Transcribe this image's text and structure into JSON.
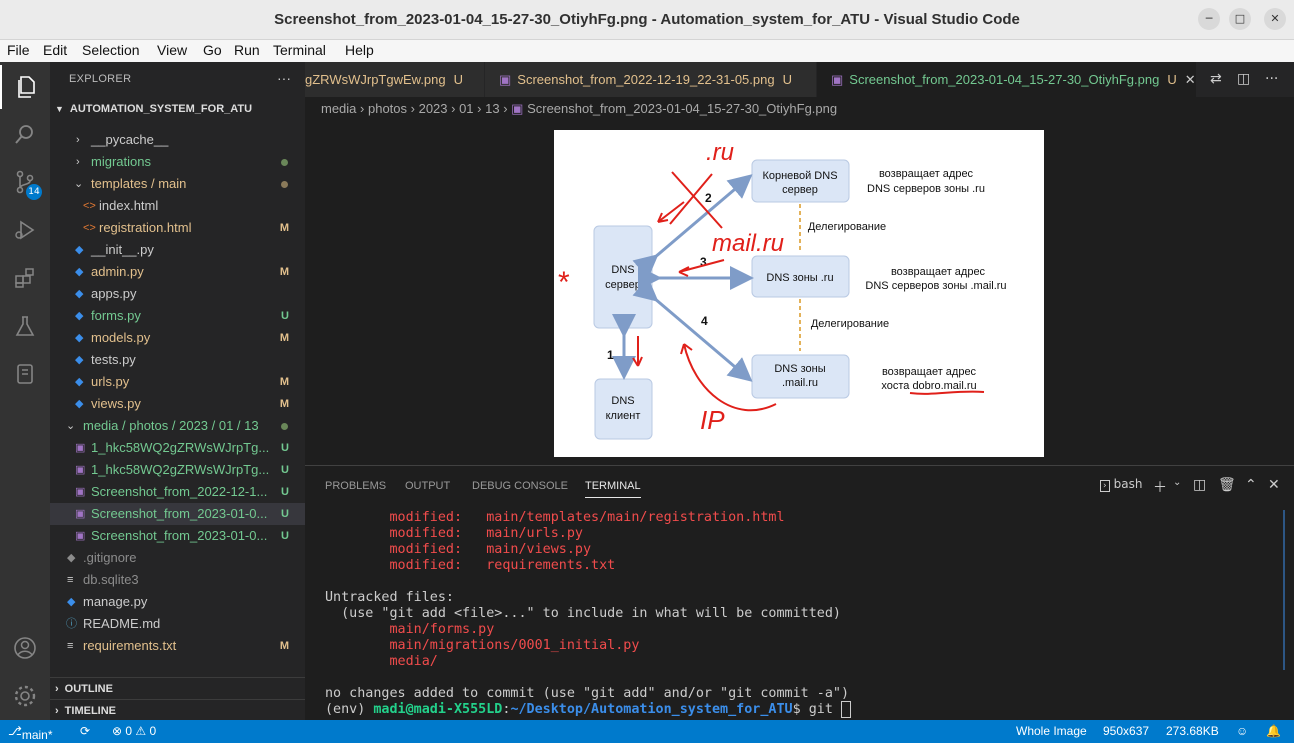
{
  "window": {
    "title": "Screenshot_from_2023-01-04_15-27-30_OtiyhFg.png - Automation_system_for_ATU - Visual Studio Code"
  },
  "menu": [
    "File",
    "Edit",
    "Selection",
    "View",
    "Go",
    "Run",
    "Terminal",
    "Help"
  ],
  "activity": {
    "scm_badge": "14"
  },
  "explorer": {
    "header": "EXPLORER",
    "more": "···",
    "project": "AUTOMATION_SYSTEM_FOR_ATU",
    "items": [
      {
        "name": "__pycache__",
        "status": ""
      },
      {
        "name": "migrations",
        "status": ""
      },
      {
        "name": "templates / main",
        "status": ""
      },
      {
        "name": "index.html",
        "status": ""
      },
      {
        "name": "registration.html",
        "status": "M"
      },
      {
        "name": "__init__.py",
        "status": ""
      },
      {
        "name": "admin.py",
        "status": "M"
      },
      {
        "name": "apps.py",
        "status": ""
      },
      {
        "name": "forms.py",
        "status": "U"
      },
      {
        "name": "models.py",
        "status": "M"
      },
      {
        "name": "tests.py",
        "status": ""
      },
      {
        "name": "urls.py",
        "status": "M"
      },
      {
        "name": "views.py",
        "status": "M"
      },
      {
        "name": "media / photos / 2023 / 01 / 13",
        "status": ""
      },
      {
        "name": "1_hkc58WQ2gZRWsWJrpTg...",
        "status": "U"
      },
      {
        "name": "1_hkc58WQ2gZRWsWJrpTg...",
        "status": "U"
      },
      {
        "name": "Screenshot_from_2022-12-1...",
        "status": "U"
      },
      {
        "name": "Screenshot_from_2023-01-0...",
        "status": "U"
      },
      {
        "name": "Screenshot_from_2023-01-0...",
        "status": "U"
      },
      {
        "name": ".gitignore",
        "status": ""
      },
      {
        "name": "db.sqlite3",
        "status": ""
      },
      {
        "name": "manage.py",
        "status": ""
      },
      {
        "name": "README.md",
        "status": ""
      },
      {
        "name": "requirements.txt",
        "status": "M"
      }
    ],
    "outline": "OUTLINE",
    "timeline": "TIMELINE"
  },
  "tabs": [
    {
      "label": "gZRWsWJrpTgwEw.png",
      "status": "U"
    },
    {
      "label": "Screenshot_from_2022-12-19_22-31-05.png",
      "status": "U"
    },
    {
      "label": "Screenshot_from_2023-01-04_15-27-30_OtiyhFg.png",
      "status": "U"
    }
  ],
  "breadcrumbs": [
    "media",
    "photos",
    "2023",
    "01",
    "13",
    "Screenshot_from_2023-01-04_15-27-30_OtiyhFg.png"
  ],
  "diagram": {
    "nodes": {
      "root": [
        "Корневой DNS",
        "сервер"
      ],
      "ru": [
        "DNS зоны .ru"
      ],
      "mailru": [
        "DNS зоны",
        ".mail.ru"
      ],
      "server": [
        "DNS",
        "сервер"
      ],
      "client": [
        "DNS",
        "клиент"
      ]
    },
    "notes": {
      "root": [
        "возвращает адрес",
        "DNS серверов зоны .ru"
      ],
      "ru": [
        "возвращает адрес",
        "DNS серверов зоны .mail.ru"
      ],
      "mailru": [
        "возвращает адрес",
        "хоста dobro.mail.ru"
      ]
    },
    "delegation": "Делегирование",
    "steps": [
      "1",
      "2",
      "3",
      "4"
    ],
    "handwritten": [
      ".ru",
      "mail.ru",
      "IP",
      "*"
    ]
  },
  "panel": {
    "tabs": [
      "PROBLEMS",
      "OUTPUT",
      "DEBUG CONSOLE",
      "TERMINAL"
    ],
    "shell": "bash"
  },
  "terminal": {
    "modified": [
      {
        "label": "modified:",
        "path": "main/templates/main/registration.html"
      },
      {
        "label": "modified:",
        "path": "main/urls.py"
      },
      {
        "label": "modified:",
        "path": "main/views.py"
      },
      {
        "label": "modified:",
        "path": "requirements.txt"
      }
    ],
    "untracked_header": "Untracked files:",
    "untracked_hint": "  (use \"git add <file>...\" to include in what will be committed)",
    "untracked": [
      "main/forms.py",
      "main/migrations/0001_initial.py",
      "media/"
    ],
    "summary": "no changes added to commit (use \"git add\" and/or \"git commit -a\")",
    "prompt_env": "(env) ",
    "prompt_user": "madi@madi-X555LD",
    "prompt_path": "~/Desktop/Automation_system_for_ATU",
    "prompt_cmd": "$ git "
  },
  "status": {
    "branch": "main*",
    "problems": "⊗ 0 ⚠ 0",
    "image_mode": "Whole Image",
    "dimensions": "950x637",
    "filesize": "273.68KB"
  }
}
